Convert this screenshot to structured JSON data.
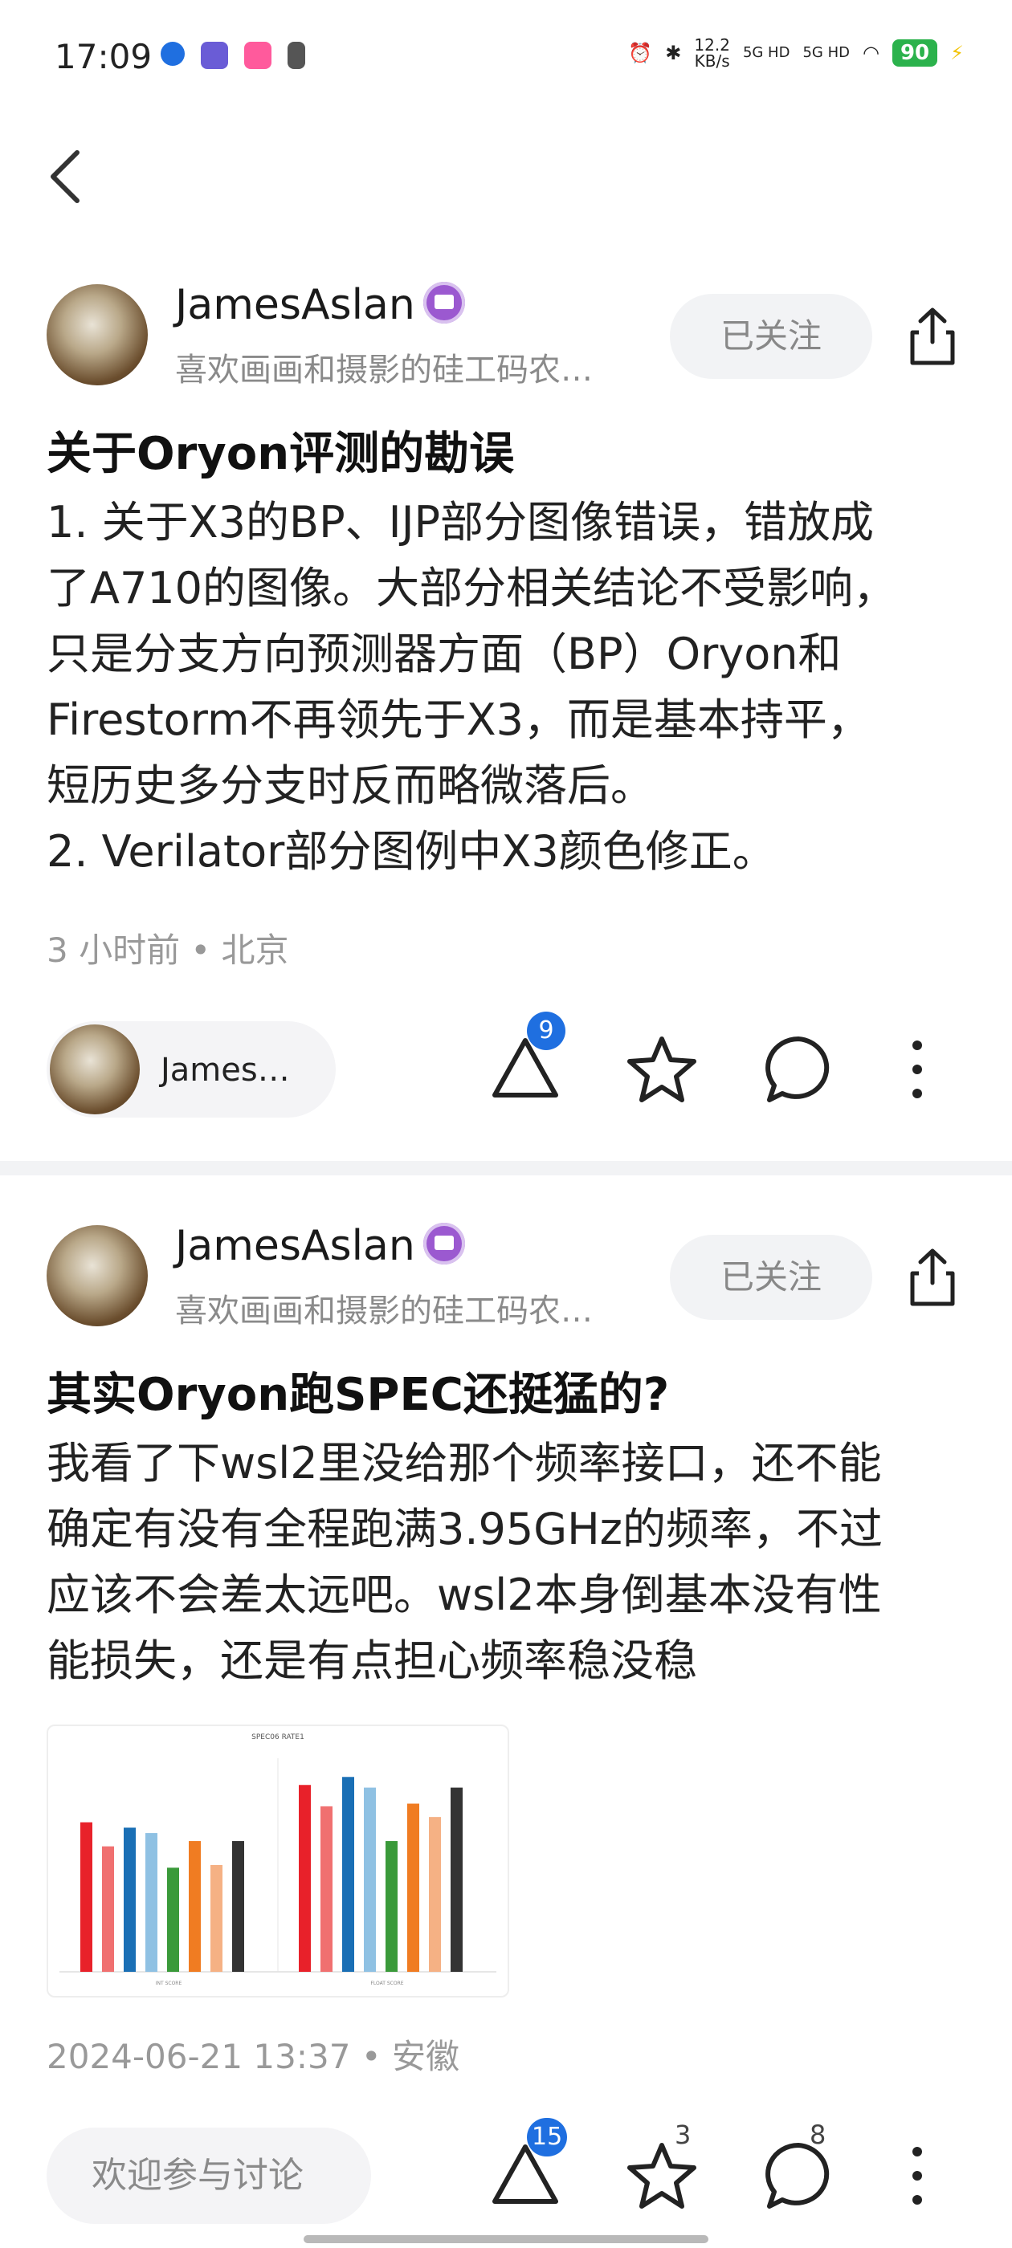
{
  "status_bar": {
    "time": "17:09",
    "speed_value": "12.2",
    "speed_unit": "KB/s",
    "net1": "5G HD",
    "net2": "5G HD",
    "battery": "90"
  },
  "posts": [
    {
      "username": "JamesAslan",
      "bio": "喜欢画画和摄影的硅工码农…",
      "follow_label": "已关注",
      "title": "关于Oryon评测的勘误",
      "content": "1. 关于X3的BP、IJP部分图像错误，错放成\n了A710的图像。大部分相关结论不受影响，\n只是分支方向预测器方面（BP）Oryon和\nFirestorm不再领先于X3，而是基本持平，\n短历史多分支时反而略微落后。\n2. Verilator部分图例中X3颜色修正。",
      "meta": "3 小时前 • 北京",
      "author_chip": "James…",
      "like_count": "9"
    },
    {
      "username": "JamesAslan",
      "bio": "喜欢画画和摄影的硅工码农…",
      "follow_label": "已关注",
      "title": "其实Oryon跑SPEC还挺猛的?",
      "content": "我看了下wsl2里没给那个频率接口，还不能\n确定有没有全程跑满3.95GHz的频率，不过\n应该不会差太远吧。wsl2本身倒基本没有性\n能损失，还是有点担心频率稳没稳",
      "meta": "2024-06-21 13:37 • 安徽",
      "comment_placeholder": "欢迎参与讨论",
      "like_count": "15",
      "star_count": "3",
      "comment_count": "8"
    }
  ],
  "chart_data": {
    "type": "bar",
    "title": "SPEC06 RATE1",
    "groups": [
      {
        "name": "INT SCORE",
        "values": [
          5.6,
          4.7,
          5.4,
          5.2,
          3.9,
          4.9,
          4.0,
          4.9
        ],
        "colors": [
          "#e8212a",
          "#f07070",
          "#1a6fb5",
          "#8fc1e3",
          "#3a9a3a",
          "#f07c22",
          "#f5b184",
          "#333333"
        ]
      },
      {
        "name": "FLOAT SCORE",
        "values": [
          7.0,
          6.2,
          7.3,
          6.9,
          4.9,
          6.3,
          5.8,
          6.9
        ],
        "colors": [
          "#e8212a",
          "#f07070",
          "#1a6fb5",
          "#8fc1e3",
          "#3a9a3a",
          "#f07c22",
          "#f5b184",
          "#333333"
        ]
      }
    ],
    "ylim": [
      0,
      8
    ]
  }
}
